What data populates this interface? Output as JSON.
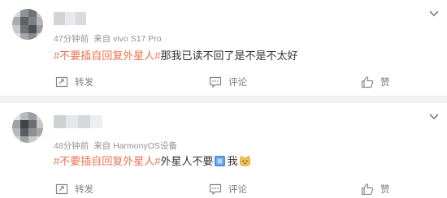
{
  "posts": [
    {
      "time": "47分钟前",
      "source": "来自 vivo S17 Pro",
      "topic": "#不要插自回复外星人#",
      "text": "那我已读不回了是不是不太好",
      "emoji_tail": "",
      "actions": {
        "repost": "转发",
        "comment": "评论",
        "like": "赞"
      }
    },
    {
      "time": "48分钟前",
      "source": "来自 HarmonyOS设备",
      "topic": "#不要插自回复外星人#",
      "text": "外星人不要",
      "text_after": "我",
      "actions": {
        "repost": "转发",
        "comment": "评论",
        "like": "赞"
      }
    }
  ],
  "icons": [
    "chevron-down-icon",
    "repost-icon",
    "comment-icon",
    "like-icon",
    "blue-block-emoji-icon",
    "cat-emoji-icon"
  ],
  "colors": {
    "topic": "#eb7350",
    "meta": "#939393",
    "action": "#808080",
    "divider": "#f0f1f4"
  }
}
